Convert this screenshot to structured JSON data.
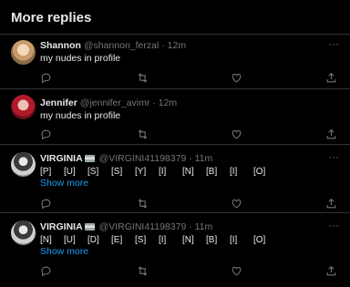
{
  "header": {
    "title": "More replies"
  },
  "replies": [
    {
      "name": "Shannon",
      "handle": "@shannon_ferzal",
      "sep": "·",
      "time": "12m",
      "text": "my nudes in profile"
    },
    {
      "name": "Jennifer",
      "handle": "@jennifer_avimr",
      "sep": "·",
      "time": "12m",
      "text": "my nudes in profile"
    },
    {
      "name": "VIRGINIA",
      "handle": "@VIRGINI41198379",
      "sep": "·",
      "time": "11m",
      "letters": [
        "[P]",
        "[U]",
        "[S]",
        "[S]",
        "[Y]",
        "[I]",
        "[N]",
        "[B]",
        "[I]",
        "[O]"
      ],
      "show_more": "Show more"
    },
    {
      "name": "VIRGINIA",
      "handle": "@VIRGINI41198379",
      "sep": "·",
      "time": "11m",
      "letters": [
        "[N]",
        "[U]",
        "[D]",
        "[E]",
        "[S]",
        "[I]",
        "[N]",
        "[B]",
        "[I]",
        "[O]"
      ],
      "show_more": "Show more"
    }
  ],
  "icons": {
    "more": "more-dots-icon",
    "reply": "reply-icon",
    "repost": "repost-icon",
    "like": "like-icon",
    "share": "share-icon",
    "badge": "verified-flag-icon"
  },
  "colors": {
    "background": "#000000",
    "text": "#e7e9ea",
    "muted": "#71767b",
    "link": "#1d9bf0",
    "divider": "#2f3336"
  }
}
